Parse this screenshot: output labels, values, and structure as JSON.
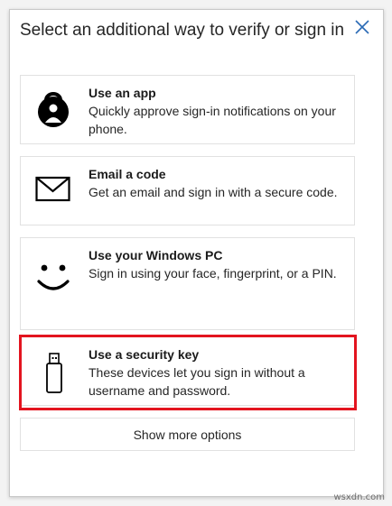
{
  "dialog": {
    "title": "Select an additional way to verify or sign in",
    "close_icon": "close-icon"
  },
  "options": [
    {
      "icon": "authenticator-app-icon",
      "title": "Use an app",
      "description": "Quickly approve sign-in notifications on your phone."
    },
    {
      "icon": "envelope-icon",
      "title": "Email a code",
      "description": "Get an email and sign in with a secure code."
    },
    {
      "icon": "smiley-face-icon",
      "title": "Use your Windows PC",
      "description": "Sign in using your face, fingerprint, or a PIN."
    },
    {
      "icon": "usb-key-icon",
      "title": "Use a security key",
      "description": "These devices let you sign in without a username and password."
    }
  ],
  "more_button": {
    "label": "Show more options"
  },
  "highlight_color": "#e3141f",
  "watermark": "wsxdn.com"
}
